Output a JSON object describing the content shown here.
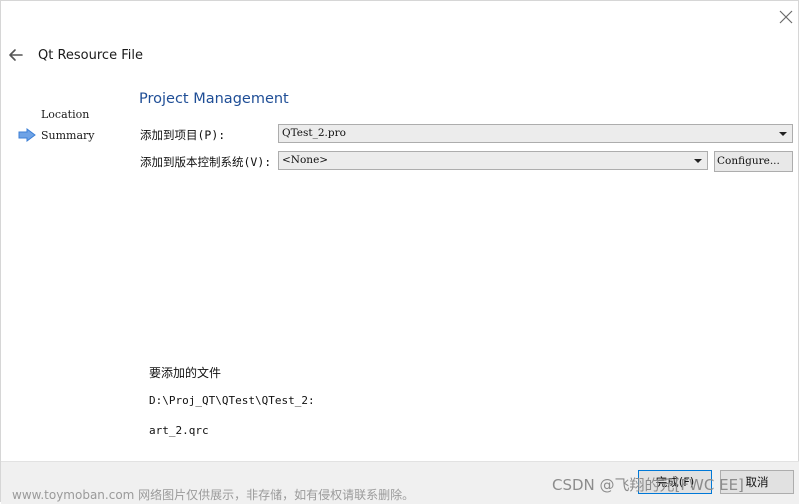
{
  "header": {
    "title": "Qt Resource File"
  },
  "wizard_steps": {
    "items": [
      {
        "label": "Location",
        "current": false
      },
      {
        "label": "Summary",
        "current": true
      }
    ]
  },
  "main": {
    "heading": "Project Management",
    "add_to_project_label": "添加到项目(P):",
    "add_to_project_value": "QTest_2.pro",
    "add_to_vcs_label": "添加到版本控制系统(V):",
    "add_to_vcs_value": "<None>",
    "configure_label": "Configure...",
    "files_title": "要添加的文件",
    "files_path": "D:\\Proj_QT\\QTest\\QTest_2:",
    "files_file": "art_2.qrc"
  },
  "footer": {
    "finish_label": "完成(F)",
    "cancel_label": "取消"
  },
  "watermarks": {
    "left": "www.toymoban.com 网络图片仅供展示，非存储，如有侵权请联系删除。",
    "right": "CSDN @飞翔的元[FWC EE]"
  },
  "colors": {
    "heading": "#1f4e96",
    "current_step_arrow": "#3c7fd6",
    "finish_button_border": "#0078d7"
  },
  "icons": {
    "close": "close-icon",
    "back": "back-arrow-icon",
    "current_step": "right-arrow-icon",
    "dropdown": "chevron-down-icon"
  }
}
